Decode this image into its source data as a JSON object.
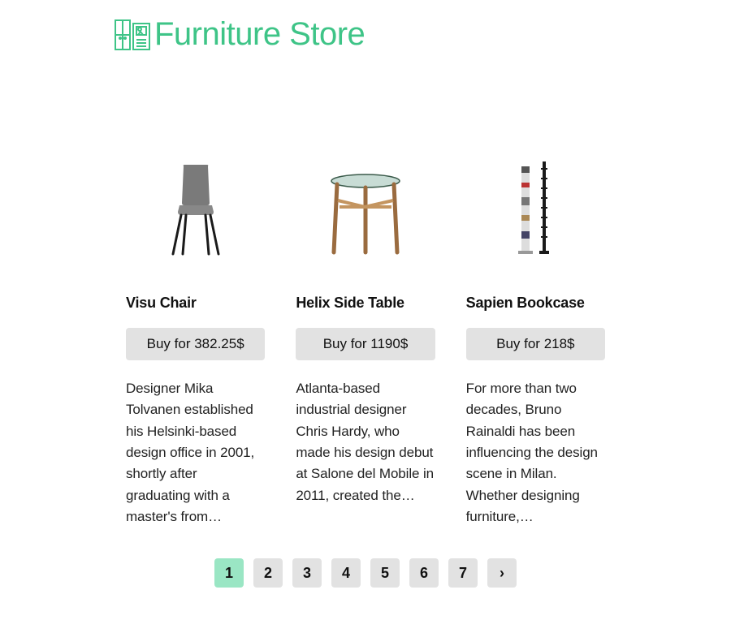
{
  "header": {
    "title": "Furniture Store"
  },
  "products": [
    {
      "title": "Visu Chair",
      "buy_label": "Buy for 382.25$",
      "description": "Designer Mika Tolvanen established his Helsinki-based design office in 2001, shortly after graduating with a master's from…"
    },
    {
      "title": "Helix Side Table",
      "buy_label": "Buy for 1190$",
      "description": "Atlanta-based industrial designer Chris Hardy, who made his design debut at Salone del Mobile in 2011, created the…"
    },
    {
      "title": "Sapien Bookcase",
      "buy_label": "Buy for 218$",
      "description": "For more than two decades, Bruno Rainaldi has been influencing the design scene in Milan. Whether designing furniture,…"
    }
  ],
  "pagination": {
    "pages": [
      "1",
      "2",
      "3",
      "4",
      "5",
      "6",
      "7"
    ],
    "next": "›",
    "active_index": 0
  }
}
